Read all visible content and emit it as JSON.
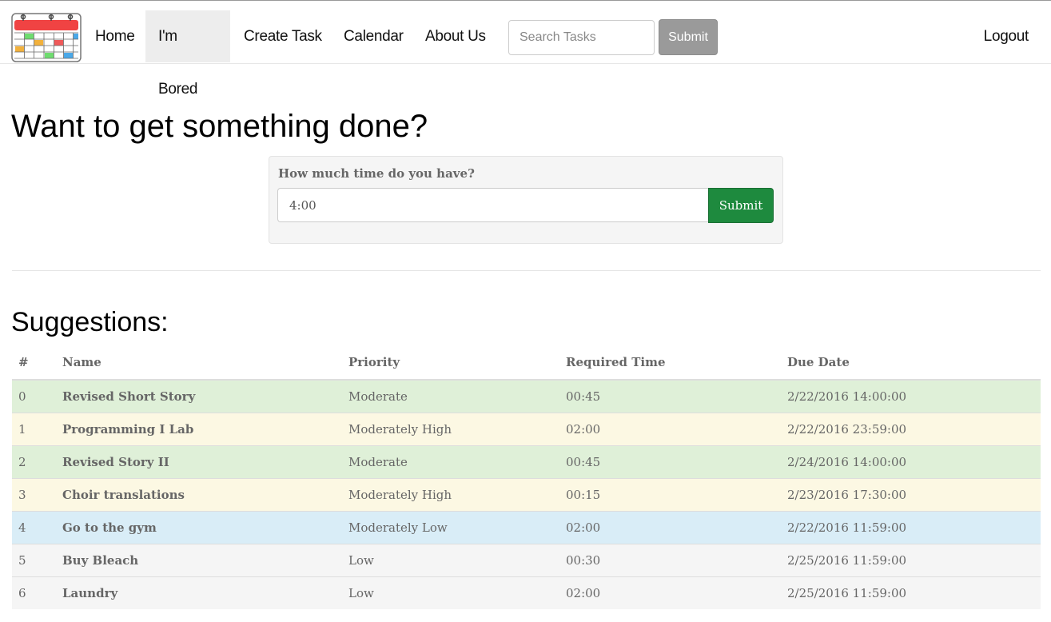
{
  "nav": {
    "items": [
      {
        "label": "Home",
        "name": "nav-home"
      },
      {
        "label": "I'm Bored",
        "name": "nav-im-bored",
        "active": true
      },
      {
        "label": "Create Task",
        "name": "nav-create-task"
      },
      {
        "label": "Calendar",
        "name": "nav-calendar"
      },
      {
        "label": "About Us",
        "name": "nav-about-us"
      }
    ],
    "search_placeholder": "Search Tasks",
    "search_submit": "Submit",
    "logout": "Logout"
  },
  "main": {
    "title": "Want to get something done?",
    "time_form": {
      "label": "How much time do you have?",
      "value": "4:00",
      "submit": "Submit"
    },
    "suggestions_title": "Suggestions:"
  },
  "table": {
    "headers": [
      "#",
      "Name",
      "Priority",
      "Required Time",
      "Due Date"
    ],
    "rows": [
      {
        "num": "0",
        "name": "Revised Short Story",
        "priority": "Moderate",
        "time": "00:45",
        "due": "2/22/2016 14:00:00"
      },
      {
        "num": "1",
        "name": "Programming I Lab",
        "priority": "Moderately High",
        "time": "02:00",
        "due": "2/22/2016 23:59:00"
      },
      {
        "num": "2",
        "name": "Revised Story II",
        "priority": "Moderate",
        "time": "00:45",
        "due": "2/24/2016 14:00:00"
      },
      {
        "num": "3",
        "name": "Choir translations",
        "priority": "Moderately High",
        "time": "00:15",
        "due": "2/23/2016 17:30:00"
      },
      {
        "num": "4",
        "name": "Go to the gym",
        "priority": "Moderately Low",
        "time": "02:00",
        "due": "2/22/2016 11:59:00"
      },
      {
        "num": "5",
        "name": "Buy Bleach",
        "priority": "Low",
        "time": "00:30",
        "due": "2/25/2016 11:59:00"
      },
      {
        "num": "6",
        "name": "Laundry",
        "priority": "Low",
        "time": "02:00",
        "due": "2/25/2016 11:59:00"
      }
    ]
  },
  "colors": {
    "priority_moderate": "#dff0d8",
    "priority_moderately_high": "#fcf8e3",
    "priority_moderately_low": "#d9edf7",
    "priority_low": "#f5f5f5",
    "time_submit": "#1e8a3e",
    "search_submit": "#9a9a9a"
  }
}
